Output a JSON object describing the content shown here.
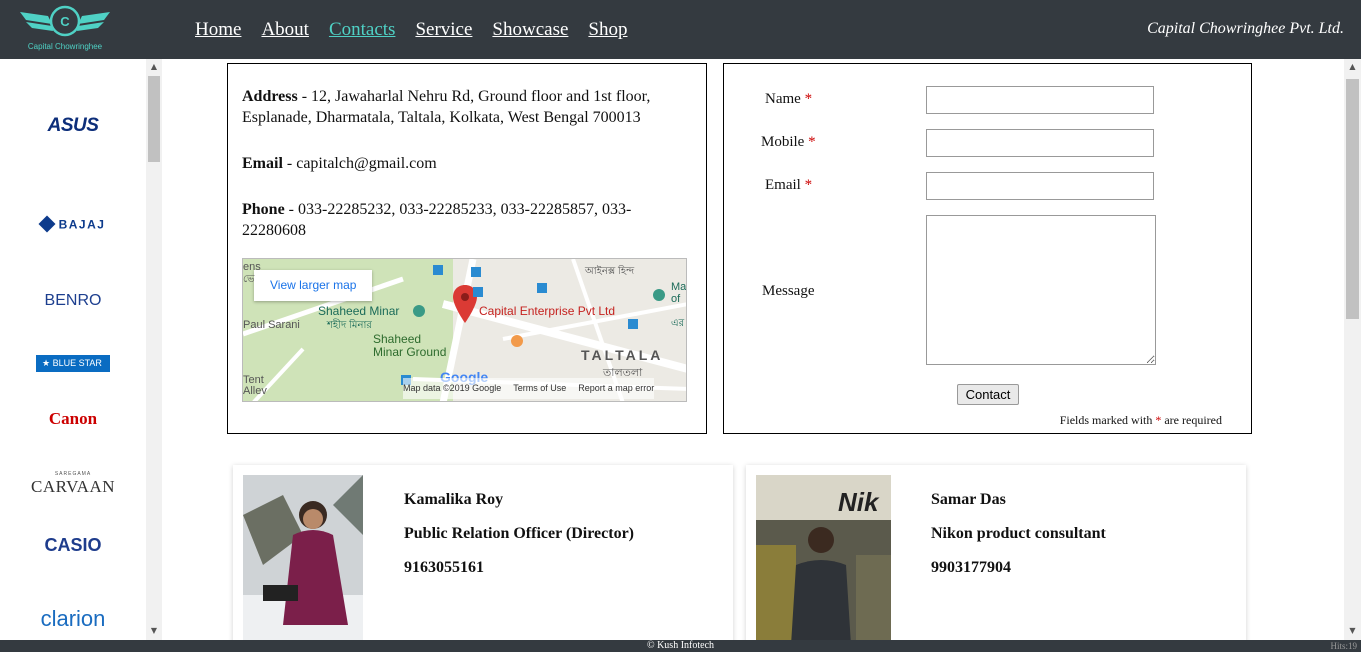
{
  "header": {
    "logo_text": "Capital Chowringhee",
    "nav": [
      {
        "label": "Home"
      },
      {
        "label": "About"
      },
      {
        "label": "Contacts"
      },
      {
        "label": "Service"
      },
      {
        "label": "Showcase"
      },
      {
        "label": "Shop"
      }
    ],
    "active_nav": "Contacts",
    "brand_right": "Capital Chowringhee Pvt. Ltd."
  },
  "sidebar": {
    "brands": [
      "ASUS",
      "BAJAJ",
      "BENRO",
      "BLUE STAR",
      "Canon",
      "SAREGAMA",
      "CARVAAN",
      "CASIO",
      "clarion"
    ]
  },
  "contact_info": {
    "address_label": "Address",
    "address": " - 12, Jawaharlal Nehru Rd, Ground floor and 1st floor, Esplanade, Dharmatala, Taltala, Kolkata, West Bengal 700013",
    "email_label": "Email",
    "email": " - capitalch@gmail.com",
    "phone_label": "Phone",
    "phone": " - 033-22285232, 033-22285233, 033-22285857, 033-22280608"
  },
  "map": {
    "view_larger": "View larger map",
    "place": "Capital Enterprise Pvt Ltd",
    "labels": [
      "Shaheed Minar",
      "শহীদ মিনার",
      "Shaheed Minar Ground",
      "TALTALA",
      "তালতলা",
      "Paul Sarani",
      "Tent Allev",
      "আইনক্স হিন্দ",
      "Mad",
      "of",
      "এর",
      "ens",
      "ভে"
    ],
    "google": "Google",
    "footer": [
      "Map data ©2019 Google",
      "Terms of Use",
      "Report a map error"
    ]
  },
  "form": {
    "name_label": "Name",
    "mobile_label": "Mobile",
    "email_label": "Email",
    "message_label": "Message",
    "required_mark": "*",
    "submit_label": "Contact",
    "note_pre": "Fields marked with ",
    "note_post": " are required"
  },
  "people": [
    {
      "name": "Kamalika Roy",
      "role": "Public Relation Officer (Director)",
      "phone": "9163055161"
    },
    {
      "name": "Samar Das",
      "role": "Nikon product consultant",
      "phone": "9903177904"
    }
  ],
  "footer": {
    "copyright": "© Kush Infotech",
    "hits": "Hits:19"
  },
  "colors": {
    "header_bg": "#343a40",
    "accent": "#4fd1c5",
    "required": "#cc0000"
  }
}
